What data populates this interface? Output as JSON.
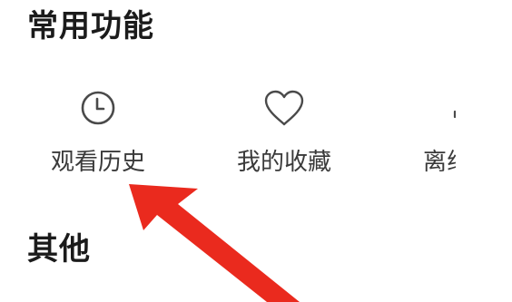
{
  "sections": {
    "common": {
      "title": "常用功能",
      "items": [
        {
          "label": "观看历史",
          "icon": "clock-icon"
        },
        {
          "label": "我的收藏",
          "icon": "heart-icon"
        },
        {
          "label": "离线",
          "icon": "download-icon"
        }
      ]
    },
    "other": {
      "title": "其他"
    }
  },
  "annotation": {
    "arrow_color": "#ea2a1e",
    "arrow_target": "观看历史"
  }
}
